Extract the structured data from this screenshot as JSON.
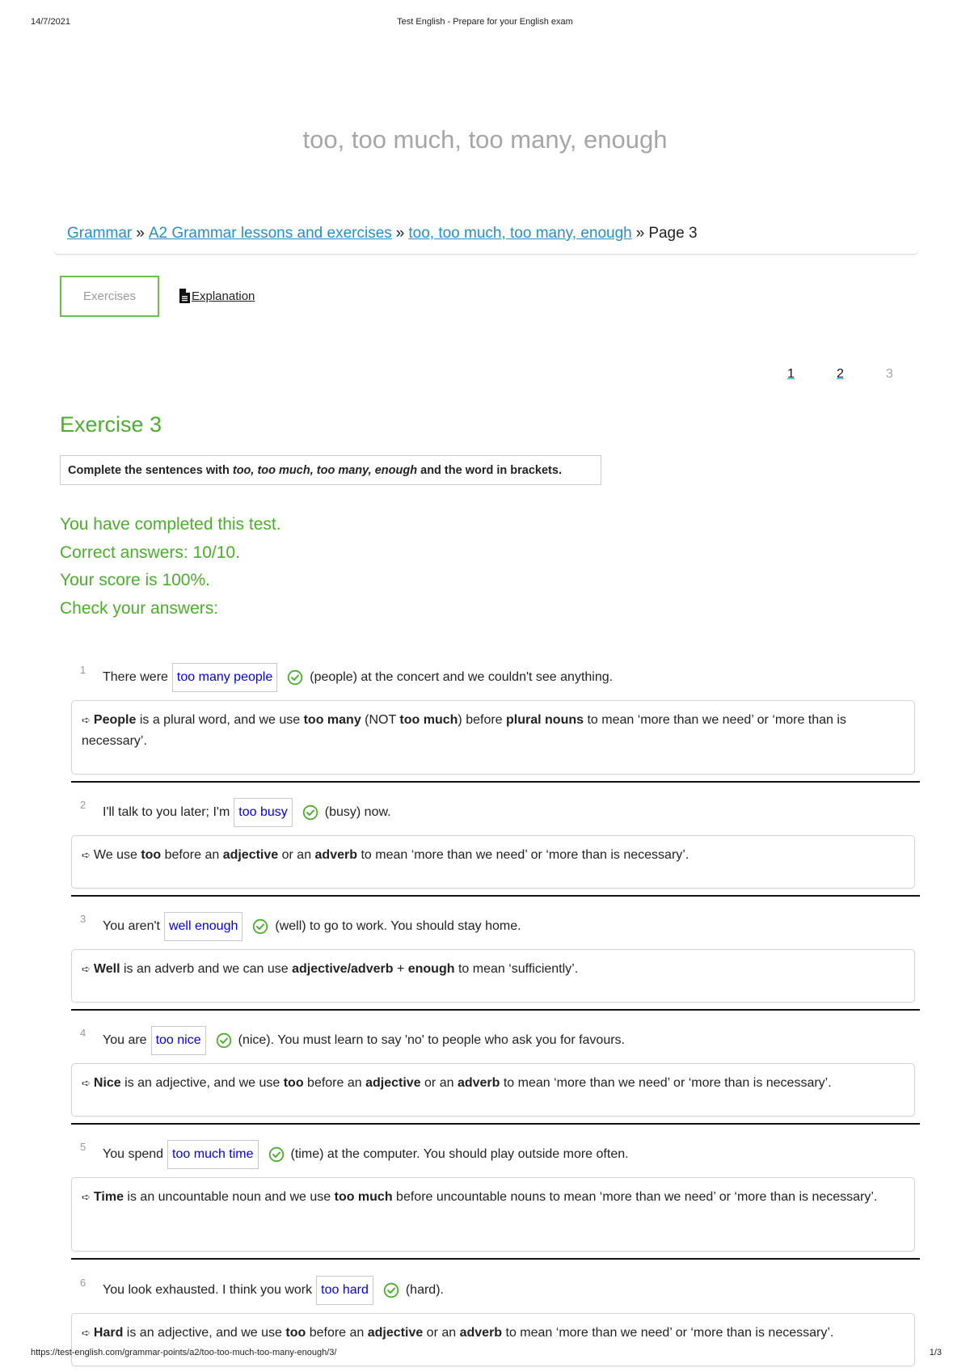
{
  "print_header": {
    "date": "14/7/2021",
    "title": "Test English - Prepare for your English exam"
  },
  "print_footer": {
    "url": "https://test-english.com/grammar-points/a2/too-too-much-too-many-enough/3/",
    "page": "1/3"
  },
  "page_title": "too, too much, too many, enough",
  "breadcrumb": {
    "items": [
      {
        "label": "Grammar",
        "link": true
      },
      {
        "label": "A2 Grammar lessons and exercises",
        "link": true
      },
      {
        "label": "too, too much, too many, enough",
        "link": true
      },
      {
        "label": "Page 3",
        "link": false
      }
    ],
    "separator": "»"
  },
  "tabs": {
    "exercises": "Exercises",
    "explanation": "Explanation"
  },
  "pagination": {
    "pages": [
      "1",
      "2",
      "3"
    ],
    "current": "3"
  },
  "exercise": {
    "title": "Exercise 3",
    "instruction_prefix": "Complete the sentences with ",
    "instruction_italic": "too, too much, too many, enough",
    "instruction_suffix": " and the word in brackets."
  },
  "results": {
    "completed": "You have completed this test.",
    "correct": "Correct answers: 10/10.",
    "score": "Your score is 100%.",
    "check": "Check your answers:"
  },
  "colors": {
    "accent_green": "#4cae2c",
    "link_blue": "#2a8ec6",
    "answer_blue": "#0000ee"
  },
  "questions": [
    {
      "num": "1",
      "before": "There were",
      "answer": "too many people",
      "after": "(people) at the concert and we couldn't see anything.",
      "explanation": [
        {
          "b": "People"
        },
        {
          "t": " is a plural word, and we use "
        },
        {
          "b": "too many"
        },
        {
          "t": " (NOT "
        },
        {
          "b": "too much"
        },
        {
          "t": ") before "
        },
        {
          "b": "plural nouns"
        },
        {
          "t": " to mean ‘more than we need’ or ‘more than is necessary’."
        }
      ]
    },
    {
      "num": "2",
      "before": "I'll talk to you later; I'm",
      "answer": "too busy",
      "after": "(busy) now.",
      "explanation": [
        {
          "t": "We use "
        },
        {
          "b": "too"
        },
        {
          "t": " before an "
        },
        {
          "b": "adjective"
        },
        {
          "t": " or an "
        },
        {
          "b": "adverb"
        },
        {
          "t": " to mean ‘more than we need’ or ‘more than is necessary’."
        }
      ]
    },
    {
      "num": "3",
      "before": "You aren't",
      "answer": "well enough",
      "after": "(well) to go to work. You should stay home.",
      "explanation": [
        {
          "b": "Well"
        },
        {
          "t": " is an adverb and we can use "
        },
        {
          "b": "adjective/adverb"
        },
        {
          "t": " + "
        },
        {
          "b": "enough"
        },
        {
          "t": " to mean ‘sufficiently’."
        }
      ]
    },
    {
      "num": "4",
      "before": "You are",
      "answer": "too nice",
      "after": "(nice). You must learn to say 'no' to people who ask you for favours.",
      "explanation": [
        {
          "b": "Nice"
        },
        {
          "t": " is an adjective, and we use "
        },
        {
          "b": "too"
        },
        {
          "t": " before an "
        },
        {
          "b": "adjective"
        },
        {
          "t": " or an "
        },
        {
          "b": "adverb"
        },
        {
          "t": " to mean ‘more than we need’ or ‘more than is necessary’."
        }
      ]
    },
    {
      "num": "5",
      "before": "You spend",
      "answer": "too much time",
      "after": "(time) at the computer. You should play outside more often.",
      "explanation": [
        {
          "b": "Time"
        },
        {
          "t": " is an uncountable noun and we use "
        },
        {
          "b": "too much"
        },
        {
          "t": " before uncountable nouns to mean ‘more than we need’ or ‘more than is necessary’."
        }
      ]
    },
    {
      "num": "6",
      "before": "You look exhausted. I think you work",
      "answer": "too hard",
      "after": "(hard).",
      "explanation": [
        {
          "b": "Hard"
        },
        {
          "t": " is an adjective, and we use "
        },
        {
          "b": "too"
        },
        {
          "t": " before an "
        },
        {
          "b": "adjective"
        },
        {
          "t": " or an "
        },
        {
          "b": "adverb"
        },
        {
          "t": " to mean ‘more than we need’ or ‘more than is necessary’."
        }
      ]
    }
  ],
  "icons": {
    "explain_arrow": "➪",
    "check": "check-circle-icon",
    "document": "document-icon"
  }
}
